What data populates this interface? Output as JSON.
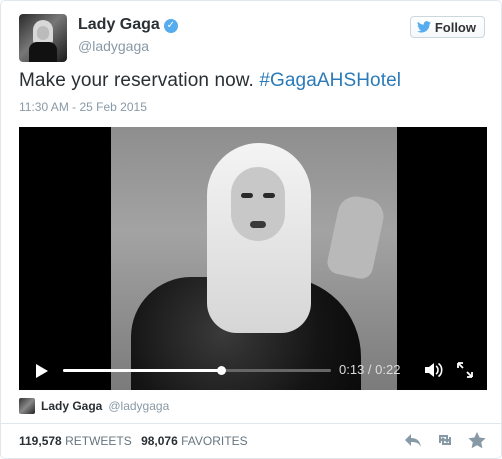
{
  "tweet": {
    "display_name": "Lady Gaga",
    "handle": "@ladygaga",
    "follow_label": "Follow",
    "text": "Make your reservation now. ",
    "hashtag": "#GagaAHSHotel",
    "timestamp": "11:30 AM - 25 Feb 2015"
  },
  "video": {
    "current_time": "0:13",
    "duration": "0:22",
    "time_display": "0:13 / 0:22",
    "progress_fraction": 0.59
  },
  "attribution": {
    "name": "Lady Gaga",
    "handle": "@ladygaga"
  },
  "stats": {
    "retweets_count": "119,578",
    "retweets_label": "RETWEETS",
    "favorites_count": "98,076",
    "favorites_label": "FAVORITES"
  },
  "colors": {
    "link": "#2b7bb9",
    "verified": "#55acee",
    "muted": "#8899a6"
  },
  "icons": [
    "verified-icon",
    "twitter-bird-icon",
    "play-icon",
    "volume-icon",
    "fullscreen-icon",
    "reply-icon",
    "retweet-icon",
    "favorite-icon"
  ]
}
